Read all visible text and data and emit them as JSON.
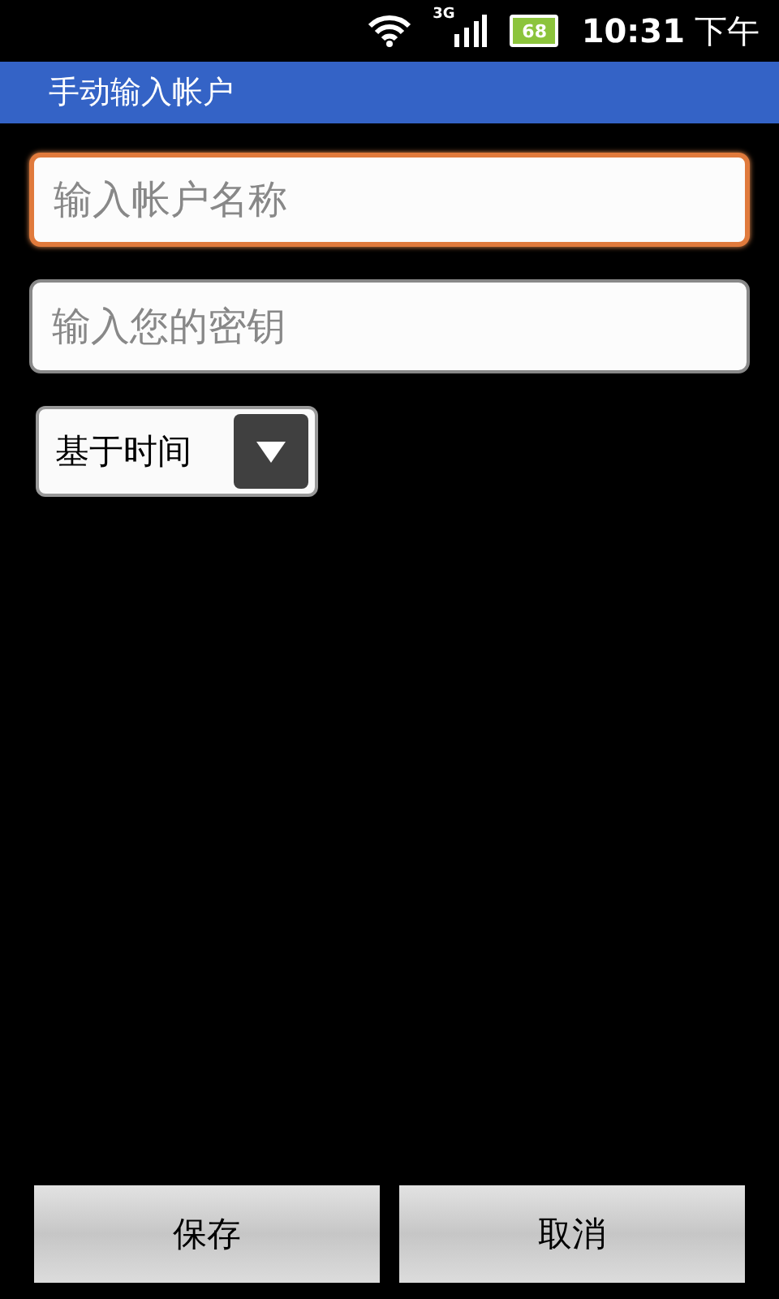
{
  "status_bar": {
    "network": "3G",
    "battery": "68",
    "time": "10:31",
    "period": "下午"
  },
  "title_bar": {
    "title": "手动输入帐户"
  },
  "fields": [
    {
      "placeholder": "输入帐户名称",
      "focused": true
    },
    {
      "placeholder": "输入您的密钥",
      "focused": false
    }
  ],
  "spinner": {
    "value": "基于时间"
  },
  "buttons": [
    {
      "label": "保存"
    },
    {
      "label": "取消"
    }
  ]
}
